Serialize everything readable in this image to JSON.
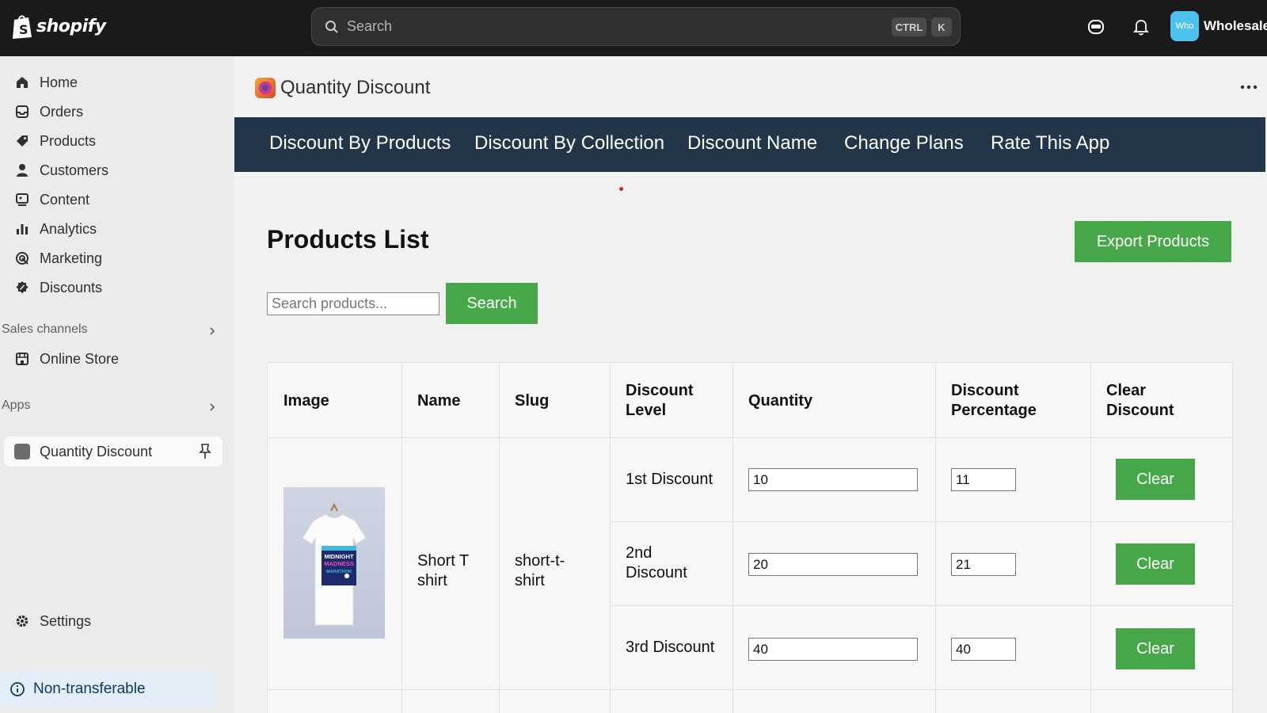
{
  "brand": {
    "name": "shopify"
  },
  "search": {
    "placeholder": "Search",
    "shortcut_ctrl": "CTRL",
    "shortcut_key": "K"
  },
  "account": {
    "avatar_text": "Who",
    "store_name": "Wholesale"
  },
  "sidebar": {
    "items": [
      {
        "label": "Home",
        "icon": "home-icon"
      },
      {
        "label": "Orders",
        "icon": "orders-icon"
      },
      {
        "label": "Products",
        "icon": "tag-icon"
      },
      {
        "label": "Customers",
        "icon": "person-icon"
      },
      {
        "label": "Content",
        "icon": "content-icon"
      },
      {
        "label": "Analytics",
        "icon": "bar-chart-icon"
      },
      {
        "label": "Marketing",
        "icon": "target-icon"
      },
      {
        "label": "Discounts",
        "icon": "discount-icon"
      }
    ],
    "sales_channels_label": "Sales channels",
    "online_store_label": "Online Store",
    "apps_label": "Apps",
    "active_app_label": "Quantity Discount",
    "settings_label": "Settings",
    "non_transferable_label": "Non-transferable"
  },
  "app": {
    "title": "Quantity Discount",
    "nav": [
      "Discount By Products",
      "Discount By Collection",
      "Discount Name",
      "Change Plans",
      "Rate This App"
    ]
  },
  "products": {
    "title": "Products List",
    "export_label": "Export Products",
    "search_placeholder": "Search products...",
    "search_button": "Search",
    "columns": [
      "Image",
      "Name",
      "Slug",
      "Discount Level",
      "Quantity",
      "Discount Percentage",
      "Clear Discount"
    ],
    "rows": [
      {
        "name": "Short T shirt",
        "slug": "short-t-shirt",
        "image_text": "MIDNIGHT MADNESS MARATHON",
        "discounts": [
          {
            "level": "1st Discount",
            "quantity": "10",
            "percentage": "11",
            "clear": "Clear"
          },
          {
            "level": "2nd Discount",
            "quantity": "20",
            "percentage": "21",
            "clear": "Clear"
          },
          {
            "level": "3rd Discount",
            "quantity": "40",
            "percentage": "40",
            "clear": "Clear"
          }
        ]
      }
    ]
  }
}
